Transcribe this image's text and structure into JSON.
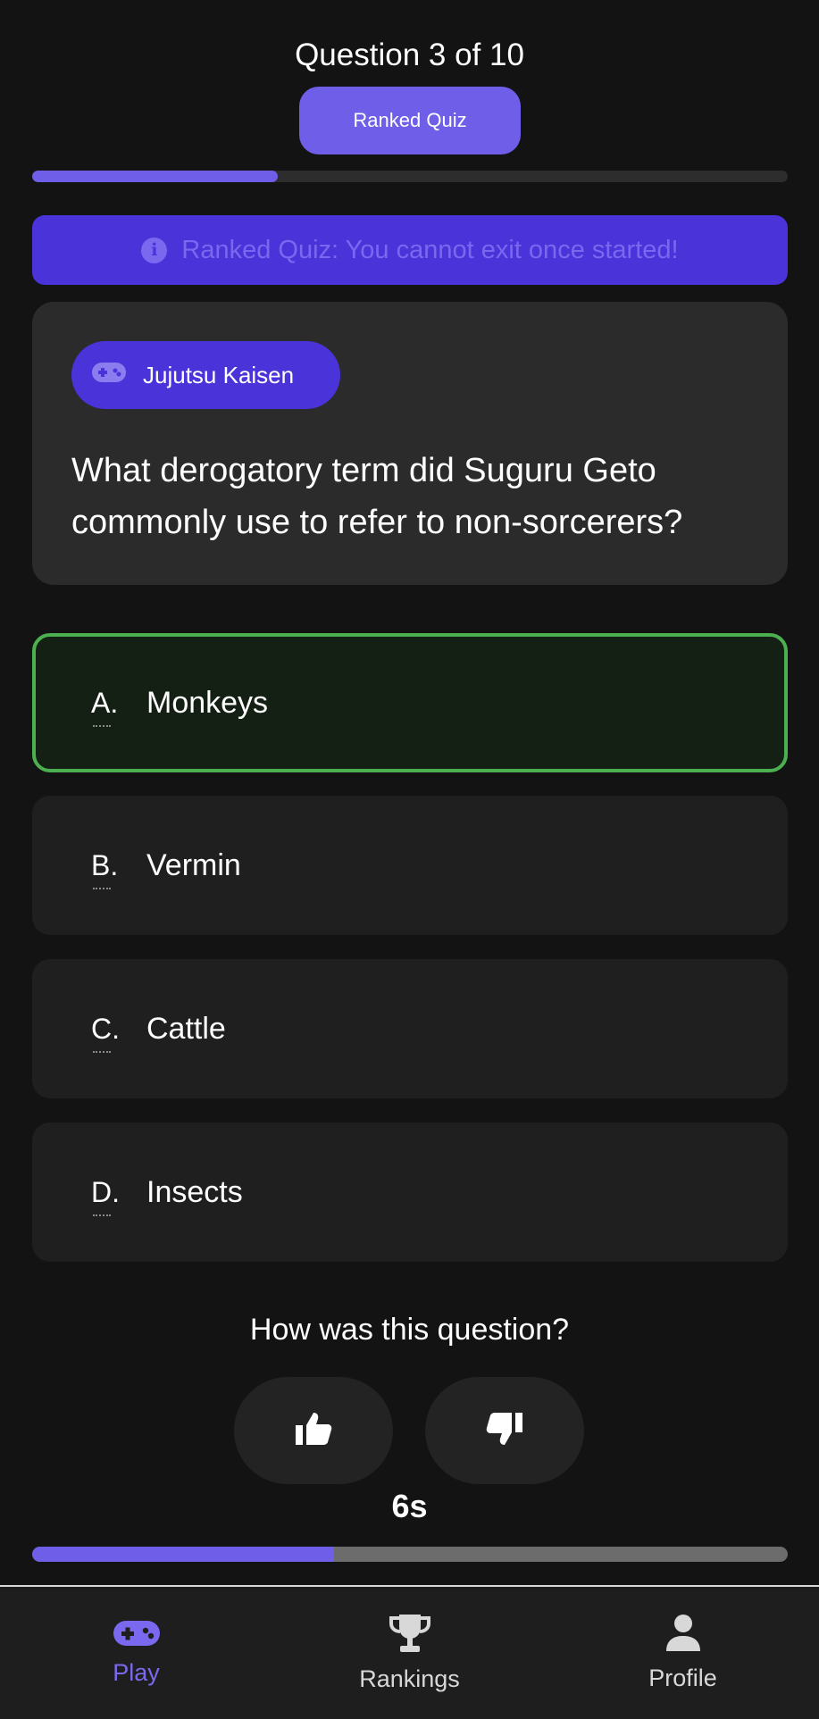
{
  "header": {
    "question_counter": "Question 3 of 10",
    "mode_label": "Ranked Quiz",
    "progress": 0.325
  },
  "notice": {
    "text": "Ranked Quiz: You cannot exit once started!",
    "icon": "info-icon"
  },
  "question": {
    "category": "Jujutsu Kaisen",
    "category_icon": "gamepad-icon",
    "text": "What derogatory term did Suguru Geto commonly use to refer to non-sorcerers?"
  },
  "answers": [
    {
      "letter": "A.",
      "text": "Monkeys",
      "state": "correct"
    },
    {
      "letter": "B.",
      "text": "Vermin",
      "state": "default"
    },
    {
      "letter": "C.",
      "text": "Cattle",
      "state": "default"
    },
    {
      "letter": "D.",
      "text": "Insects",
      "state": "default"
    }
  ],
  "feedback": {
    "prompt": "How was this question?",
    "like_icon": "thumbs-up-icon",
    "dislike_icon": "thumbs-down-icon"
  },
  "timer": {
    "label": "6s",
    "progress": 0.4
  },
  "nav": {
    "items": [
      {
        "label": "Play",
        "icon": "gamepad-icon",
        "active": true
      },
      {
        "label": "Rankings",
        "icon": "trophy-icon",
        "active": false
      },
      {
        "label": "Profile",
        "icon": "person-icon",
        "active": false
      }
    ]
  },
  "colors": {
    "accent": "#6f5ee8",
    "notice_bg": "#4a33d9",
    "correct": "#4caf50",
    "background": "#131313"
  }
}
